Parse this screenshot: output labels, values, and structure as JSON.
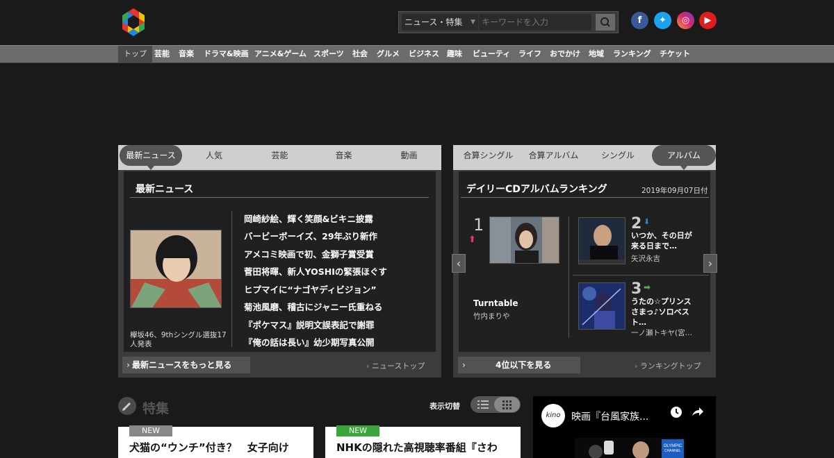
{
  "header": {
    "search": {
      "category": "ニュース・特集",
      "placeholder": "キーワードを入力"
    },
    "social": [
      "facebook-icon",
      "twitter-icon",
      "instagram-icon",
      "youtube-icon"
    ],
    "colors": {
      "logo": [
        "#e5352d",
        "#f2c200",
        "#34a853",
        "#1e88e5"
      ]
    }
  },
  "nav": {
    "items": [
      "トップ",
      "芸能",
      "音楽",
      "ドラマ&映画",
      "アニメ&ゲーム",
      "スポーツ",
      "社会",
      "グルメ",
      "ビジネス",
      "趣味",
      "ビューティ",
      "ライフ",
      "おでかけ",
      "地域",
      "ランキング",
      "チケット"
    ]
  },
  "news_panel": {
    "tabs": [
      "最新ニュース",
      "人気",
      "芸能",
      "音楽",
      "動画"
    ],
    "title": "最新ニュース",
    "photo_caption": "欅坂46、9thシングル選抜17人発表",
    "links": [
      "岡崎紗絵、輝く笑顔&ビキニ披露",
      "バービーボーイズ、29年ぶり新作",
      "アメコミ映画で初、金獅子賞受賞",
      "菅田将暉、新人YOSHIの緊張ほぐす",
      "ヒプマイに“ナゴヤディビジョン”",
      "菊池風磨、稽古にジャニー氏重ねる",
      "『ポケマス』説明文誤表記で謝罪",
      "『俺の話は長い』幼少期写真公開"
    ],
    "more": "最新ニュースをもっと見る",
    "top_link": "ニューストップ"
  },
  "ranking_panel": {
    "tabs": [
      "合算シングル",
      "合算アルバム",
      "シングル",
      "アルバム"
    ],
    "title": "デイリーCDアルバムランキング",
    "date": "2019年09月07日付",
    "items": [
      {
        "rank": "1",
        "title": "Turntable",
        "artist": "竹内まりや",
        "trend": "up"
      },
      {
        "rank": "2",
        "title": "いつか、その日が来る日まで…",
        "artist": "矢沢永吉",
        "trend": "down"
      },
      {
        "rank": "3",
        "title": "うたの☆プリンスさまっ♪ソロベスト…",
        "artist": "一ノ瀬トキヤ(宮…",
        "trend": "same"
      }
    ],
    "more": "4位以下を見る",
    "top_link": "ランキングトップ"
  },
  "feature": {
    "title": "特集",
    "view_label": "表示切替",
    "cards": [
      {
        "badge": "NEW",
        "badge_color": "#888888",
        "text": "犬猫の“ウンチ”付き？　女子向け"
      },
      {
        "badge": "NEW",
        "badge_color": "#3aa53a",
        "text": "NHKの隠れた高視聴率番組『さわ"
      }
    ]
  },
  "video": {
    "channel": "kino",
    "title": "映画『台風家族..."
  }
}
